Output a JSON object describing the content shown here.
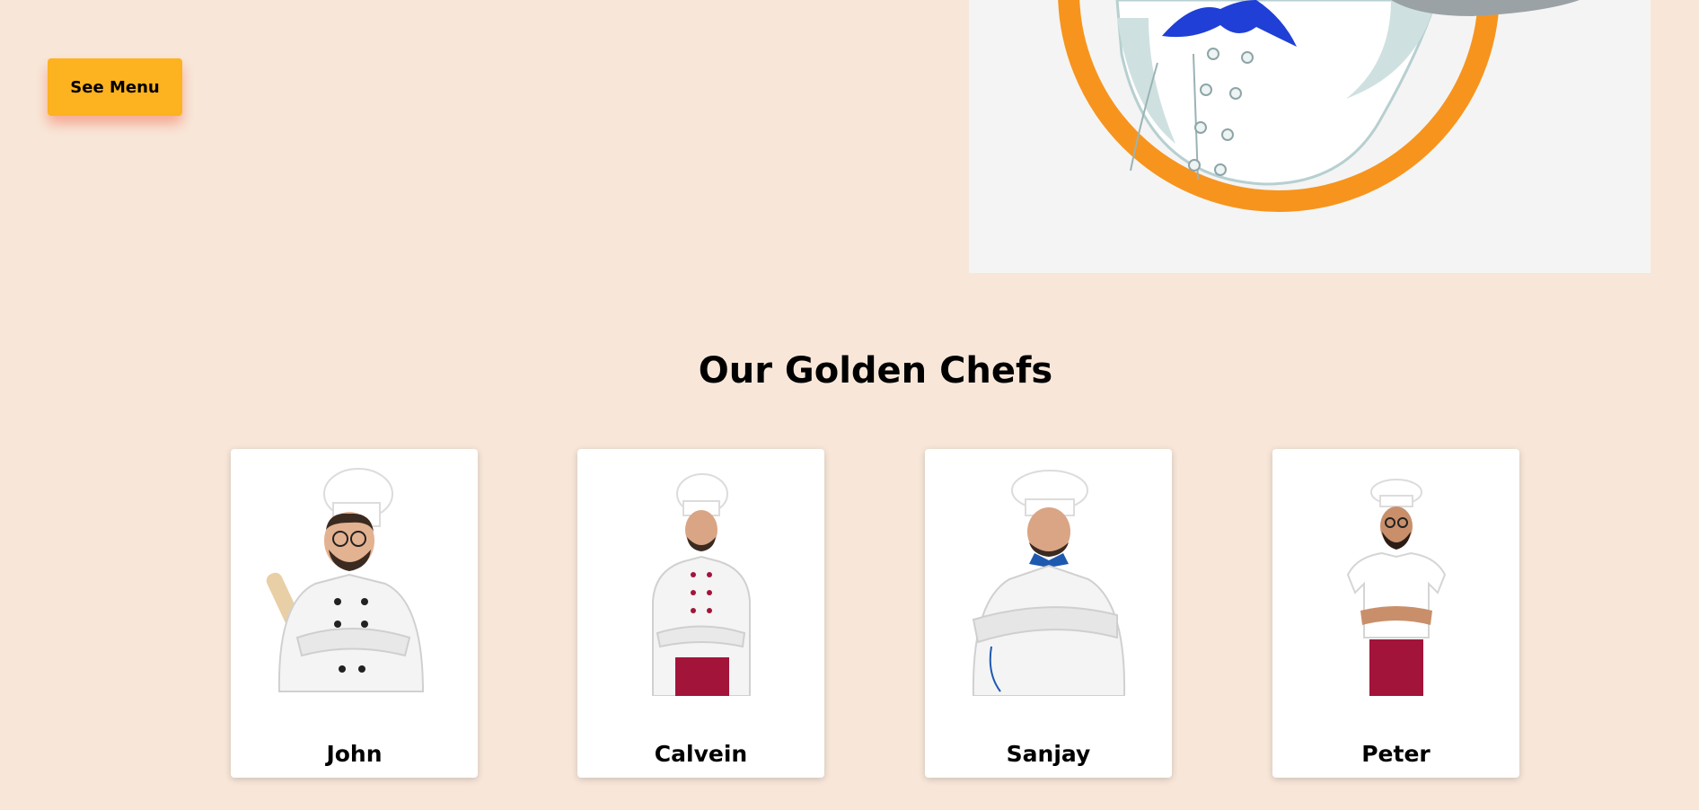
{
  "hero": {
    "see_menu_label": "See Menu"
  },
  "chefs_section": {
    "title": "Our Golden Chefs",
    "chefs": [
      {
        "name": "John"
      },
      {
        "name": "Calvein"
      },
      {
        "name": "Sanjay"
      },
      {
        "name": "Peter"
      }
    ]
  },
  "colors": {
    "page_background": "#f8e7d9",
    "button": "#fdb21f",
    "logo_ring": "#f7941d",
    "scarf": "#1f3fd6",
    "apron": "#a3143a"
  }
}
